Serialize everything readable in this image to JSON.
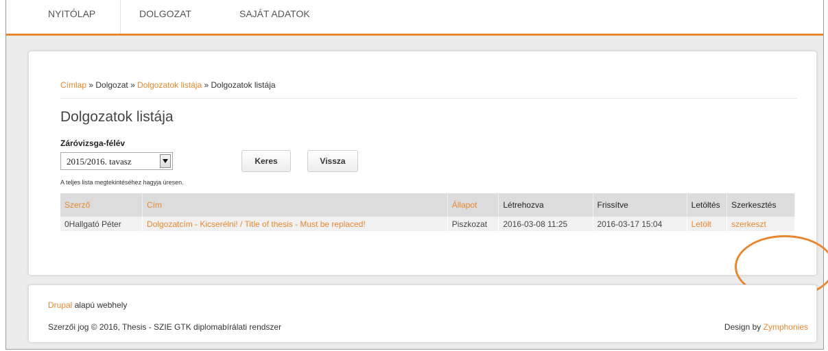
{
  "nav": {
    "items": [
      {
        "label": "NYITÓLAP"
      },
      {
        "label": "DOLGOZAT"
      },
      {
        "label": "SAJÁT ADATOK"
      }
    ]
  },
  "breadcrumb": {
    "home": "Címlap",
    "sep": " » ",
    "part2": "Dolgozat",
    "part3": "Dolgozatok listája",
    "current": "Dolgozatok listája"
  },
  "page": {
    "title": "Dolgozatok listája"
  },
  "filter": {
    "label": "Záróvizsga-félév",
    "selected": "2015/2016. tavasz",
    "hint": "A teljes lista megtekintéséhez hagyja üresen.",
    "search_label": "Keres",
    "back_label": "Vissza"
  },
  "table": {
    "headers": [
      "Szerző",
      "Cím",
      "Állapot",
      "Létrehozva",
      "Frissítve",
      "Letöltés",
      "Szerkesztés"
    ],
    "rows": [
      {
        "author": "0Hallgató Péter",
        "title": "Dolgozatcím - Kicserélni! / Title of thesis - Must be replaced!",
        "status": "Piszkozat",
        "created": "2016-03-08 11:25",
        "updated": "2016-03-17 15:04",
        "download": "Letölt",
        "edit": "szerkeszt"
      }
    ]
  },
  "footer": {
    "drupal_link": "Drupal",
    "drupal_rest": " alapú webhely",
    "copyright": "Szerzői jog © 2016, Thesis - SZIE GTK diplomabírálati rendszer",
    "design_by": "Design by ",
    "designer": "Zymphonies"
  },
  "colors": {
    "accent": "#e8872f",
    "header_bg": "#dcdcdc",
    "row_bg": "#f1f1f1"
  }
}
